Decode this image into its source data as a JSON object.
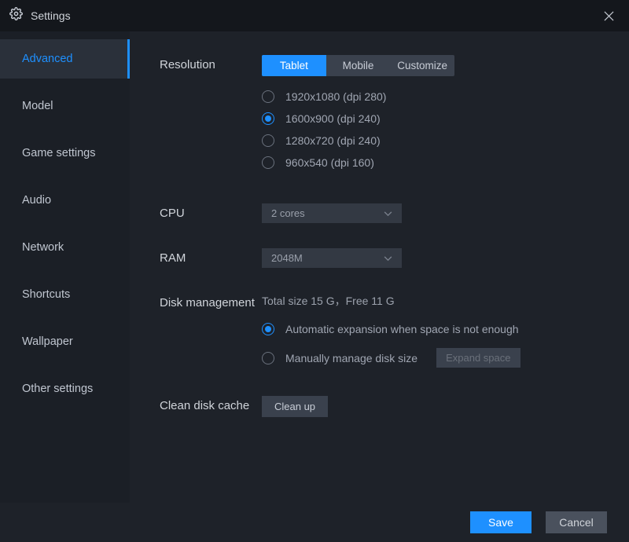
{
  "titlebar": {
    "title": "Settings"
  },
  "sidebar": {
    "items": [
      {
        "label": "Advanced",
        "active": true
      },
      {
        "label": "Model",
        "active": false
      },
      {
        "label": "Game settings",
        "active": false
      },
      {
        "label": "Audio",
        "active": false
      },
      {
        "label": "Network",
        "active": false
      },
      {
        "label": "Shortcuts",
        "active": false
      },
      {
        "label": "Wallpaper",
        "active": false
      },
      {
        "label": "Other settings",
        "active": false
      }
    ]
  },
  "resolution": {
    "label": "Resolution",
    "tabs": [
      {
        "label": "Tablet",
        "active": true
      },
      {
        "label": "Mobile",
        "active": false
      },
      {
        "label": "Customize",
        "active": false
      }
    ],
    "options": [
      {
        "label": "1920x1080  (dpi 280)",
        "selected": false
      },
      {
        "label": "1600x900  (dpi 240)",
        "selected": true
      },
      {
        "label": "1280x720  (dpi 240)",
        "selected": false
      },
      {
        "label": "960x540  (dpi 160)",
        "selected": false
      }
    ]
  },
  "cpu": {
    "label": "CPU",
    "value": "2 cores"
  },
  "ram": {
    "label": "RAM",
    "value": "2048M"
  },
  "disk": {
    "label": "Disk management",
    "info": "Total size 15 G，Free 11 G",
    "options": [
      {
        "label": "Automatic expansion when space is not enough",
        "selected": true
      },
      {
        "label": "Manually manage disk size",
        "selected": false
      }
    ],
    "expand_label": "Expand space"
  },
  "cache": {
    "label": "Clean disk cache",
    "button": "Clean up"
  },
  "footer": {
    "save": "Save",
    "cancel": "Cancel"
  }
}
